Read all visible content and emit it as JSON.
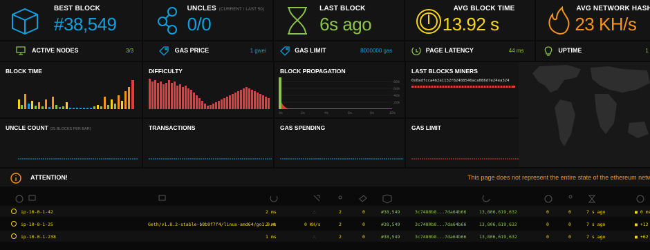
{
  "stats": {
    "best_block": {
      "label": "BEST BLOCK",
      "value": "#38,549"
    },
    "uncles": {
      "label": "UNCLES",
      "sub": "(CURRENT / LAST 50)",
      "value": "0/0"
    },
    "last_block": {
      "label": "LAST BLOCK",
      "value": "6s ago"
    },
    "avg_block_time": {
      "label": "AVG BLOCK TIME",
      "value": "13.92 s"
    },
    "avg_hashrate": {
      "label": "AVG NETWORK HASHRATE",
      "value": "23 KH/s"
    }
  },
  "small_stats": {
    "active_nodes": {
      "label": "ACTIVE NODES",
      "value": "3/3"
    },
    "gas_price": {
      "label": "GAS PRICE",
      "value": "1 gwei"
    },
    "gas_limit": {
      "label": "GAS LIMIT",
      "value": "8000000 gas"
    },
    "page_latency": {
      "label": "PAGE LATENCY",
      "value": "44 ms"
    },
    "uptime": {
      "label": "UPTIME",
      "value": "1"
    }
  },
  "charts": {
    "block_time": {
      "label": "BLOCK TIME"
    },
    "difficulty": {
      "label": "DIFFICULTY"
    },
    "block_propagation": {
      "label": "BLOCK PROPAGATION",
      "y_ticks": [
        "80%",
        "60%",
        "40%",
        "20%"
      ],
      "x_ticks": [
        "0s",
        "2s",
        "4s",
        "6s",
        "8s",
        "10s"
      ]
    },
    "last_blocks_miners": {
      "label": "LAST BLOCKS MINERS",
      "miner": "0x0adfcca4b2a1132f82488546aca086d7e24ea324"
    },
    "uncle_count": {
      "label": "UNCLE COUNT",
      "sub": "(25 BLOCKS PER BAR)"
    },
    "transactions": {
      "label": "TRANSACTIONS"
    },
    "gas_spending": {
      "label": "GAS SPENDING"
    },
    "gas_limit": {
      "label": "GAS LIMIT"
    }
  },
  "attention": {
    "label": "ATTENTION!",
    "message": "This page does not represent the entire state of the ethereum network"
  },
  "nodes": [
    {
      "name": "ip-10-0-1-42",
      "info": "",
      "latency": "2 ms",
      "hashrate": "",
      "peers": "2",
      "pending": "0",
      "block": "#38,549",
      "hash": "3c7480b8...7da64b66",
      "difficulty": "13,806,619,632",
      "uncles": "0",
      "txs": "0",
      "last": "7 s ago",
      "prop": "0 ms"
    },
    {
      "name": "ip-10-0-1-25",
      "info": "Geth/v1.8.2-stable-b8b9f7f4/linux-amd64/go1.9.4",
      "latency": "2 ms",
      "hashrate": "0 KH/s",
      "peers": "2",
      "pending": "0",
      "block": "#38,549",
      "hash": "3c7480b8...7da64b66",
      "difficulty": "13,806,619,632",
      "uncles": "0",
      "txs": "0",
      "last": "7 s ago",
      "prop": "+12"
    },
    {
      "name": "ip-10-0-1-238",
      "info": "",
      "latency": "1 ms",
      "hashrate": "",
      "peers": "2",
      "pending": "0",
      "block": "#38,549",
      "hash": "3c7480b8...7da64b66",
      "difficulty": "13,806,619,632",
      "uncles": "0",
      "txs": "0",
      "last": "7 s ago",
      "prop": "+62"
    }
  ],
  "colors": {
    "blue": "#10a0de",
    "green": "#8bc34a",
    "orange": "#f7941d",
    "yellow": "#f7d51d",
    "red": "#e8393c"
  }
}
